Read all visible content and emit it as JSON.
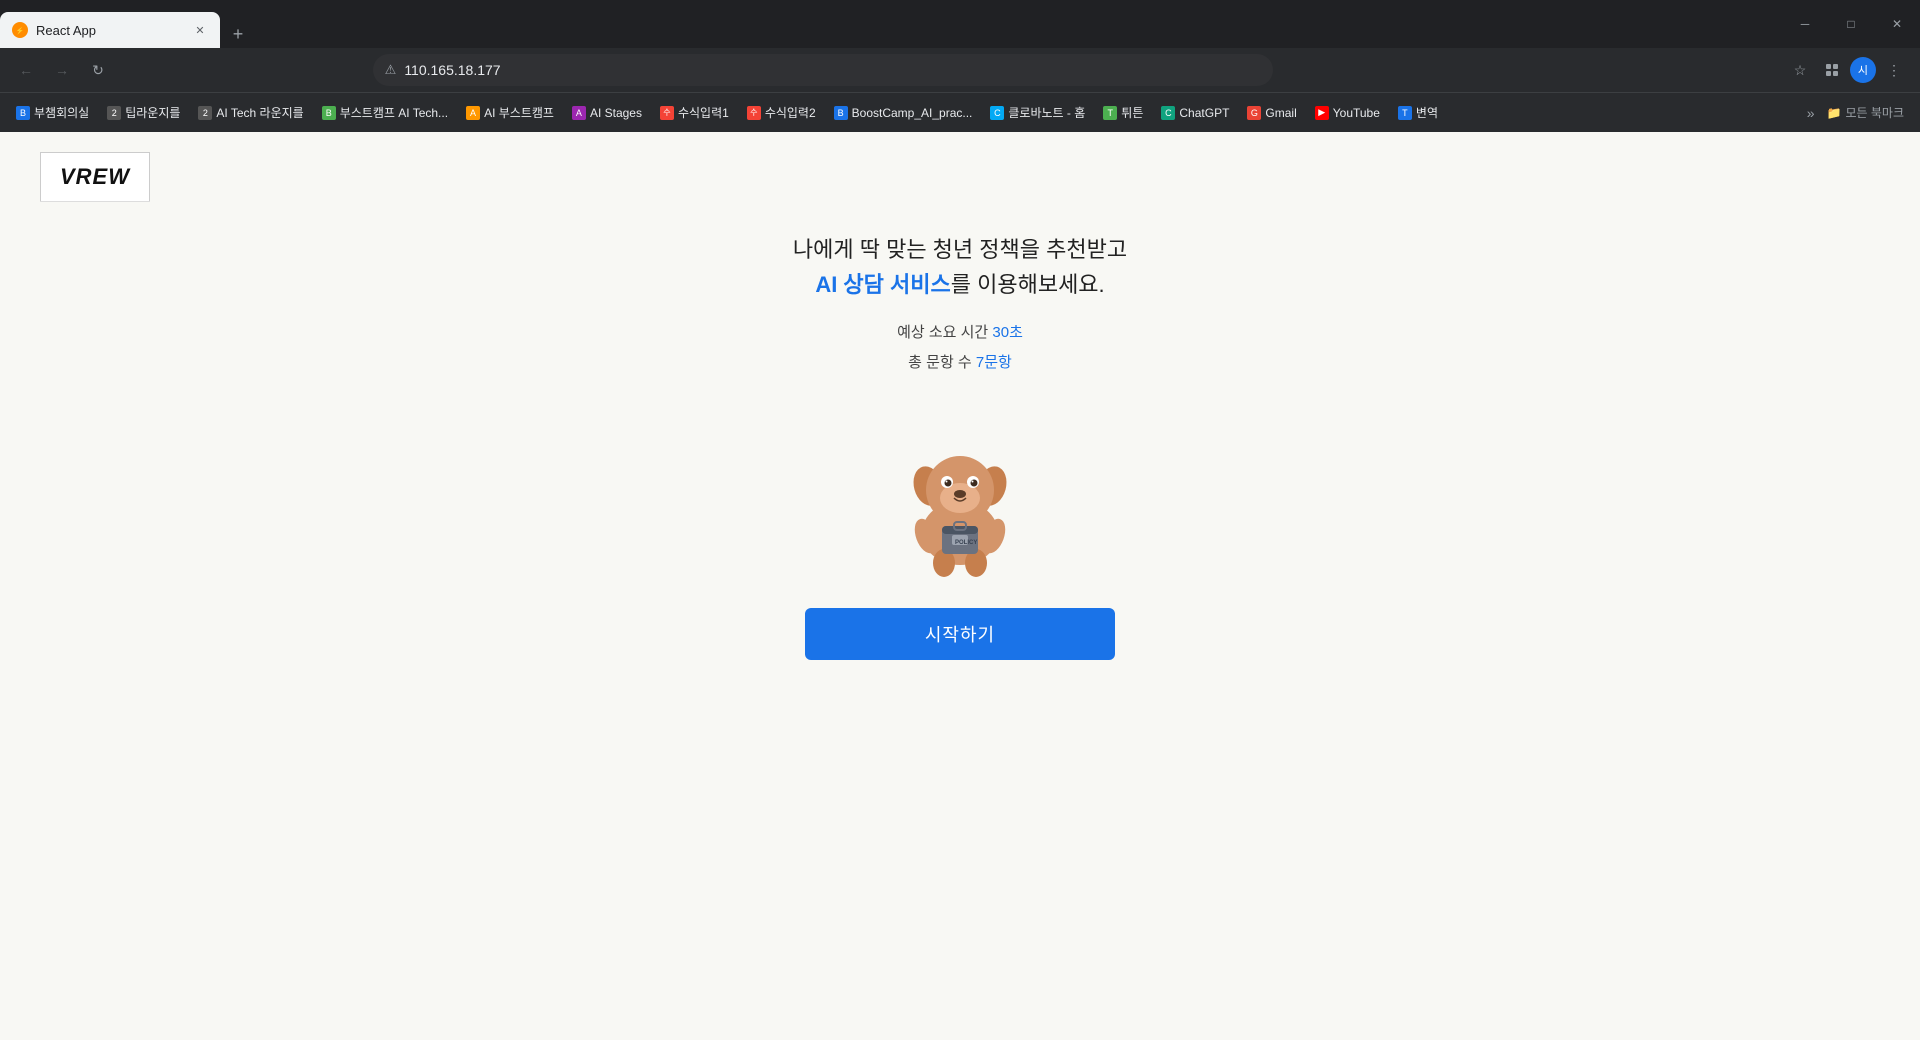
{
  "browser": {
    "tab": {
      "title": "React App",
      "favicon": "⚡"
    },
    "new_tab_label": "+",
    "address": "110.165.18.177",
    "address_icon": "⚠",
    "window_controls": {
      "minimize": "─",
      "maximize": "□",
      "close": "✕"
    },
    "toolbar": {
      "back": "←",
      "forward": "→",
      "reload": "↻",
      "bookmark_star": "☆",
      "extensions": "⬡",
      "profile": "시",
      "menu": "⋮"
    }
  },
  "bookmarks": [
    {
      "id": "bk1",
      "label": "부챔회의실",
      "icon_color": "#1a73e8",
      "icon_text": "B"
    },
    {
      "id": "bk2",
      "label": "팁라운지를",
      "icon_color": "#1a73e8",
      "icon_text": "2"
    },
    {
      "id": "bk3",
      "label": "AI Tech 라운지를",
      "icon_color": "#555",
      "icon_text": "2"
    },
    {
      "id": "bk4",
      "label": "부스트캠프 AI Tech...",
      "icon_color": "#4caf50",
      "icon_text": "B"
    },
    {
      "id": "bk5",
      "label": "AI 부스트캠프",
      "icon_color": "#ff9800",
      "icon_text": "A"
    },
    {
      "id": "bk6",
      "label": "AI Stages",
      "icon_color": "#9c27b0",
      "icon_text": "A"
    },
    {
      "id": "bk7",
      "label": "수식입력1",
      "icon_color": "#f44336",
      "icon_text": "수"
    },
    {
      "id": "bk8",
      "label": "수식입력2",
      "icon_color": "#f44336",
      "icon_text": "수"
    },
    {
      "id": "bk9",
      "label": "BoostCamp_AI_prac...",
      "icon_color": "#1a73e8",
      "icon_text": "B"
    },
    {
      "id": "bk10",
      "label": "클로바노트 - 홈",
      "icon_color": "#03a9f4",
      "icon_text": "C"
    },
    {
      "id": "bk11",
      "label": "튀튼",
      "icon_color": "#4caf50",
      "icon_text": "T"
    },
    {
      "id": "bk12",
      "label": "ChatGPT",
      "icon_color": "#10a37f",
      "icon_text": "C"
    },
    {
      "id": "bk13",
      "label": "Gmail",
      "icon_color": "#ea4335",
      "icon_text": "G"
    },
    {
      "id": "bk14",
      "label": "YouTube",
      "icon_color": "#ff0000",
      "icon_text": "▶"
    },
    {
      "id": "bk15",
      "label": "변역",
      "icon_color": "#1a73e8",
      "icon_text": "T"
    }
  ],
  "bookmarks_more": {
    "label": "모든 북마크",
    "icon": "📁"
  },
  "page": {
    "logo": "VREW",
    "headline_line1": "나에게 딱 맞는 청년 정책을 추천받고",
    "headline_line2_prefix": "",
    "headline_line2_highlight": "AI 상담 서비스",
    "headline_line2_suffix": "를 이용해보세요.",
    "meta_time_prefix": "예상 소요 시간 ",
    "meta_time_highlight": "30초",
    "meta_questions_prefix": "총 문항 수 ",
    "meta_questions_highlight": "7문항",
    "start_button": "시작하기"
  }
}
